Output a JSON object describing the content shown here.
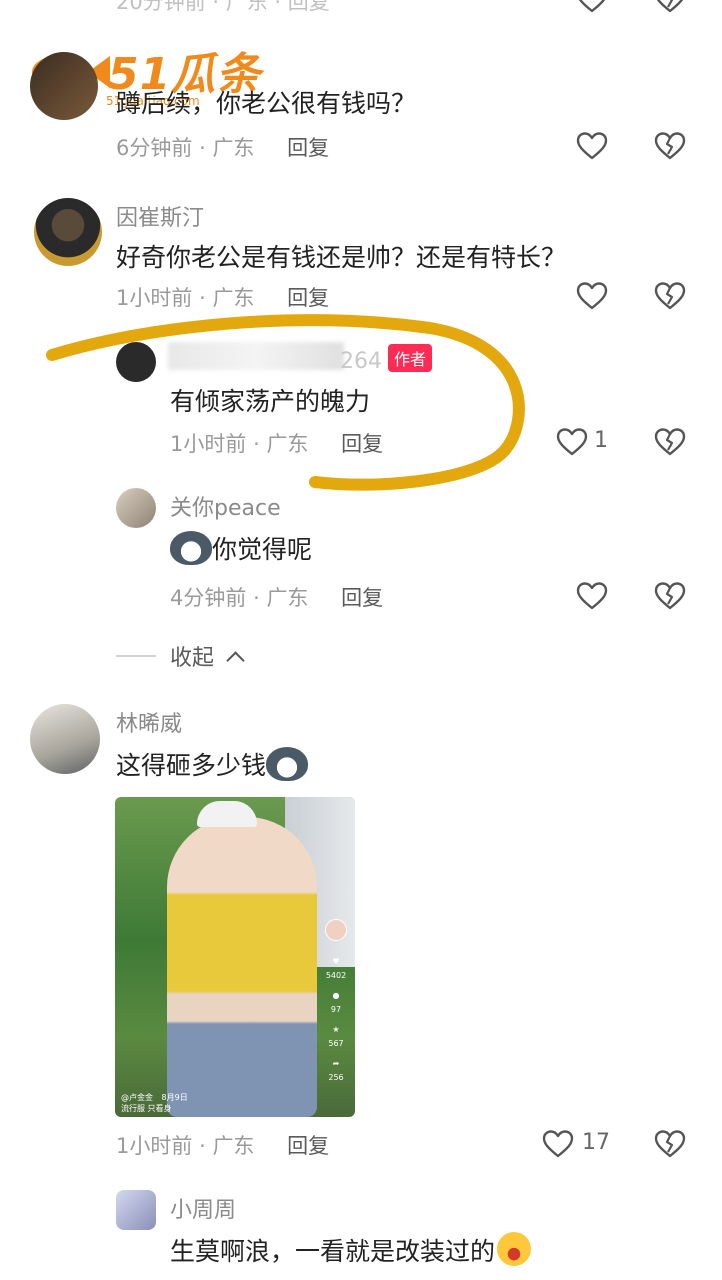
{
  "watermark": {
    "logo_text": "51瓜条",
    "url_text": "51gua.tiao.com"
  },
  "comments": [
    {
      "name": "",
      "text": "蹲后续，你老公很有钱吗？",
      "time": "6分钟前",
      "location": "广东",
      "reply": "回复",
      "likes": ""
    },
    {
      "name": "因崔斯汀",
      "text": "好奇你老公是有钱还是帅？还是有特长？",
      "time": "1小时前",
      "location": "广东",
      "reply": "回复",
      "likes": ""
    }
  ],
  "replies": [
    {
      "name": "264",
      "badge": "作者",
      "text": "有倾家荡产的魄力",
      "time": "1小时前",
      "location": "广东",
      "reply": "回复",
      "likes": "1"
    },
    {
      "name": "关你peace",
      "text": "你觉得呢",
      "time": "4分钟前",
      "location": "广东",
      "reply": "回复",
      "likes": ""
    }
  ],
  "collapse": {
    "label": "收起"
  },
  "comment3": {
    "name": "林晞威",
    "text": "这得砸多少钱",
    "time": "1小时前",
    "location": "广东",
    "reply": "回复",
    "likes": "17"
  },
  "video": {
    "counts": [
      "5402",
      "97",
      "567",
      "256"
    ],
    "author": "@卢金金",
    "caption": "流行服 只看身",
    "date": "8月9日"
  },
  "reply4": {
    "name": "小周周",
    "text": "生莫啊浪，一看就是改装过的"
  },
  "separator": "·",
  "colors": {
    "accent": "#fe2c55",
    "highlight": "#e3a80e",
    "text": "#222222",
    "meta": "#9a9a9a"
  }
}
